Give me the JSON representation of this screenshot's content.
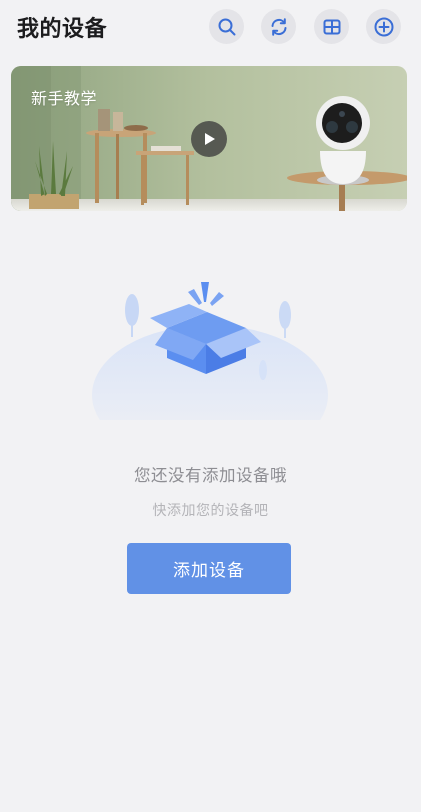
{
  "header": {
    "title": "我的设备",
    "actions": [
      {
        "icon": "search-icon"
      },
      {
        "icon": "refresh-icon"
      },
      {
        "icon": "grid-view-icon"
      },
      {
        "icon": "add-circle-icon"
      }
    ]
  },
  "banner": {
    "title": "新手教学",
    "play_icon": "play-icon"
  },
  "empty_state": {
    "title": "您还没有添加设备哦",
    "subtitle": "快添加您的设备吧",
    "illustration": "empty-box-illustration"
  },
  "add_button": {
    "label": "添加设备"
  },
  "colors": {
    "background": "#f2f2f4",
    "accent": "#6191e6",
    "header_button_bg": "#e4e4e8",
    "icon_blue": "#3a6ed6"
  }
}
